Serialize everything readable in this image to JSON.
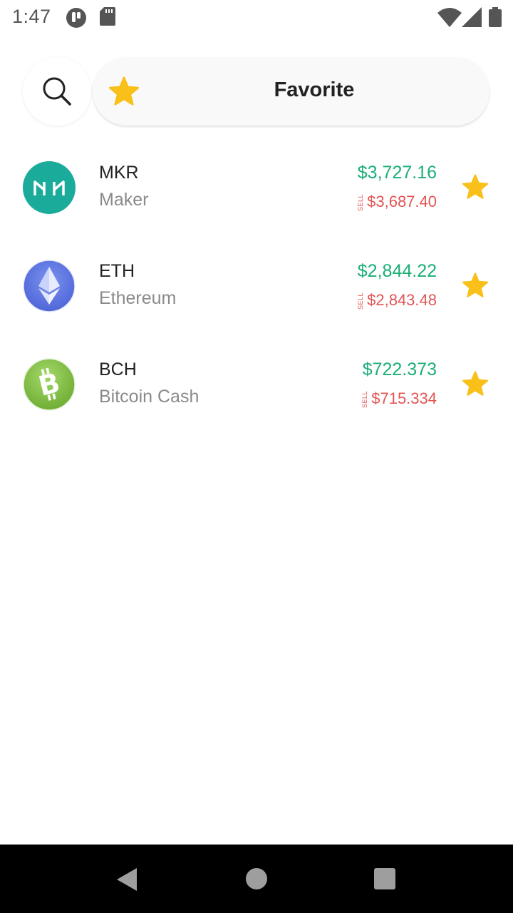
{
  "status_bar": {
    "time": "1:47",
    "icons": [
      "app-notification-icon",
      "sd-card-icon",
      "wifi-icon",
      "cell-signal-icon",
      "battery-icon"
    ]
  },
  "header": {
    "search_icon": "search-icon",
    "favorite_label": "Favorite",
    "favorite_icon": "star-icon"
  },
  "coins": [
    {
      "symbol": "MKR",
      "name": "Maker",
      "buy": "$3,727.16",
      "sell_tag": "SELL",
      "sell": "$3,687.40",
      "logo_color": "#1aab9b",
      "favorited": true
    },
    {
      "symbol": "ETH",
      "name": "Ethereum",
      "buy": "$2,844.22",
      "sell_tag": "SELL",
      "sell": "$2,843.48",
      "logo_color": "#627eea",
      "favorited": true
    },
    {
      "symbol": "BCH",
      "name": "Bitcoin Cash",
      "buy": "$722.373",
      "sell_tag": "SELL",
      "sell": "$715.334",
      "logo_color": "#8dc351",
      "favorited": true
    }
  ],
  "colors": {
    "buy": "#1aaf76",
    "sell": "#e35454",
    "star": "#f9c01a"
  },
  "nav_bar": {
    "back_icon": "back-triangle-icon",
    "home_icon": "home-circle-icon",
    "recents_icon": "recents-square-icon"
  }
}
